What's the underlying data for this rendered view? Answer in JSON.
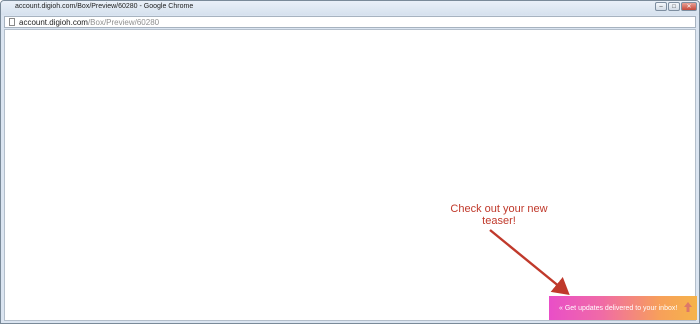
{
  "window": {
    "title": "account.digioh.com/Box/Preview/60280 - Google Chrome",
    "controls": {
      "minimize": "–",
      "maximize": "□",
      "close": "✕"
    }
  },
  "addressbar": {
    "host": "account.digioh.com",
    "path": "/Box/Preview/60280",
    "icon": "page-icon"
  },
  "annotation": {
    "text": "Check out your new teaser!",
    "color": "#c0392b"
  },
  "teaser": {
    "text": "« Get updates delivered to your inbox!",
    "icon": "up-arrow-icon",
    "colors": [
      "#e94ec8",
      "#f06aa7",
      "#f7a05a",
      "#f6b34a"
    ]
  }
}
